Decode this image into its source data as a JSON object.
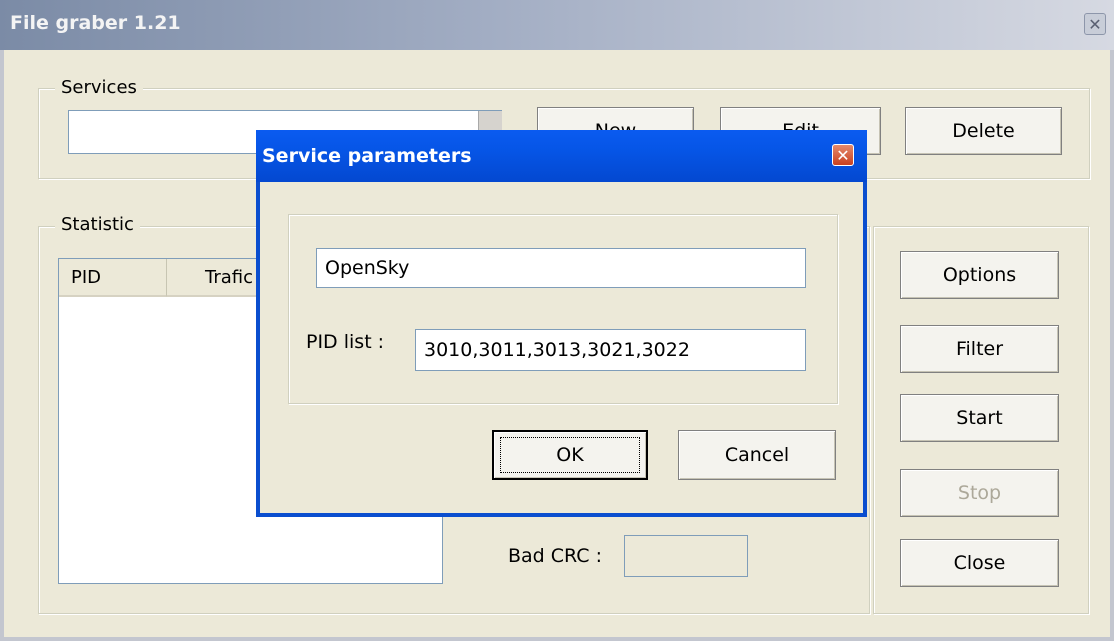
{
  "window": {
    "title": "File graber 1.21",
    "close_glyph": "✕"
  },
  "services": {
    "group_label": "Services",
    "combo_value": "",
    "new_label": "New",
    "edit_label": "Edit",
    "delete_label": "Delete"
  },
  "statistic": {
    "group_label": "Statistic",
    "columns": [
      "PID",
      "Trafic"
    ],
    "bad_crc_label": "Bad CRC :",
    "bad_crc_value": ""
  },
  "side_buttons": {
    "options": "Options",
    "filter": "Filter",
    "start": "Start",
    "stop": "Stop",
    "close": "Close"
  },
  "dialog": {
    "title": "Service parameters",
    "close_glyph": "✕",
    "name_value": "OpenSky",
    "pid_label": "PID list :",
    "pid_value": "3010,3011,3013,3021,3022",
    "ok_label": "OK",
    "cancel_label": "Cancel"
  },
  "colors": {
    "dialog_title_bar": "#0a55e6",
    "inactive_title_bar": "#a3aec4",
    "window_bg": "#ece9d8"
  }
}
